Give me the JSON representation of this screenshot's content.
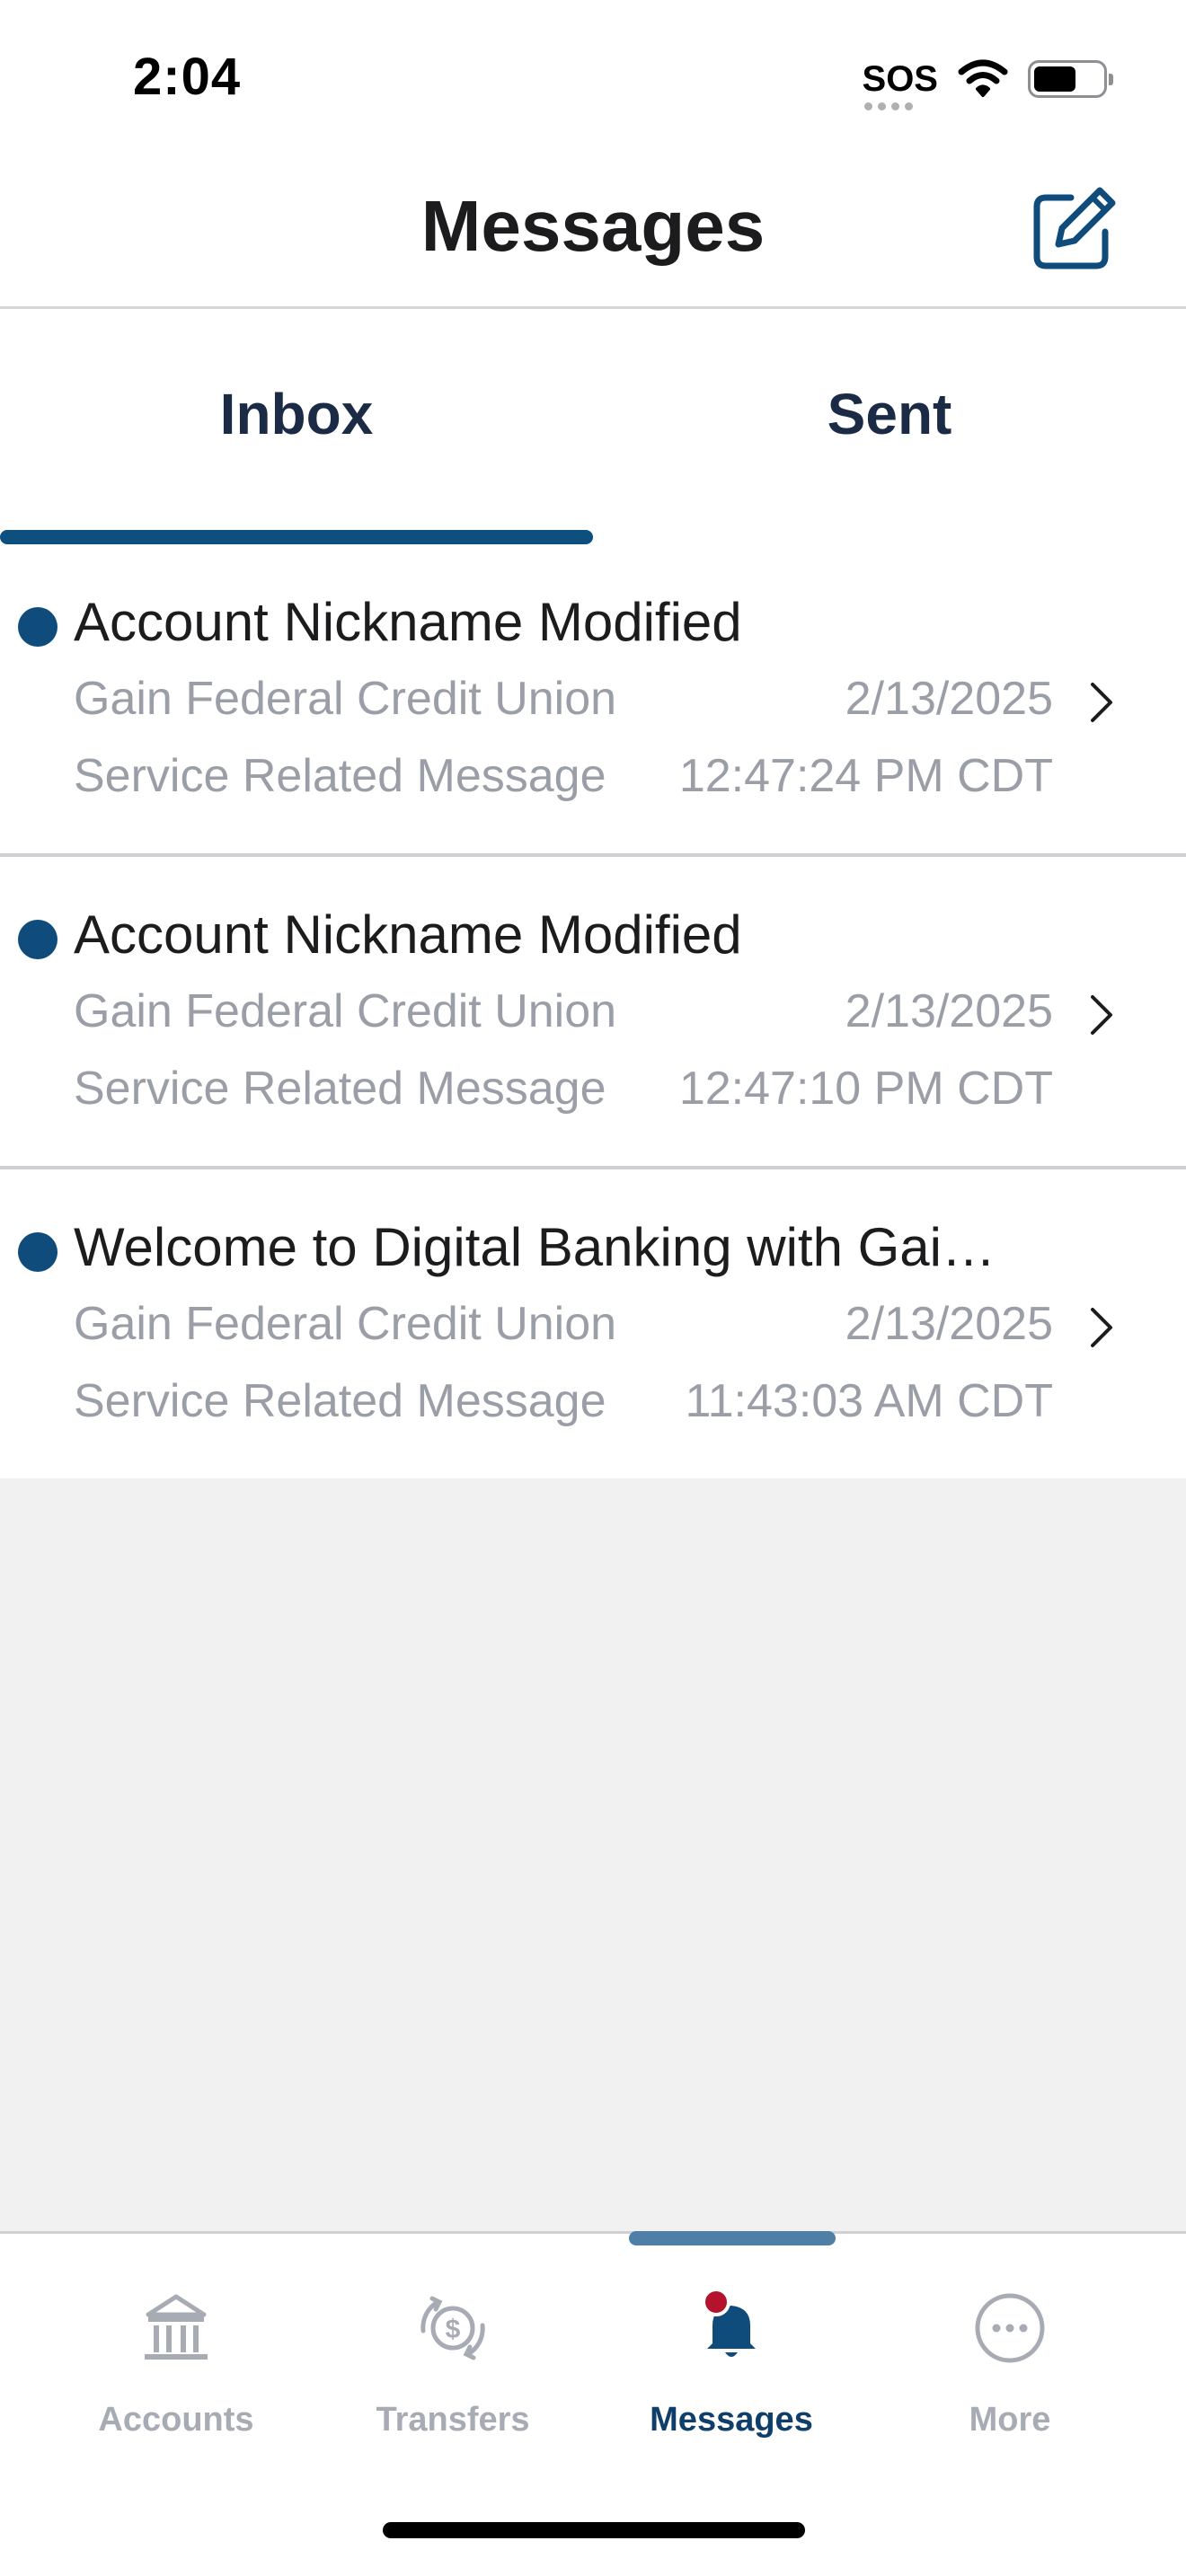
{
  "status_bar": {
    "time": "2:04",
    "sos": "SOS"
  },
  "header": {
    "title": "Messages",
    "compose_icon": "compose-icon"
  },
  "tabs": [
    {
      "label": "Inbox",
      "active": true
    },
    {
      "label": "Sent",
      "active": false
    }
  ],
  "messages": [
    {
      "title": "Account Nickname Modified",
      "sender": "Gain Federal Credit Union",
      "category": "Service Related Message",
      "date": "2/13/2025",
      "time": "12:47:24 PM CDT",
      "unread": true
    },
    {
      "title": "Account Nickname Modified",
      "sender": "Gain Federal Credit Union",
      "category": "Service Related Message",
      "date": "2/13/2025",
      "time": "12:47:10 PM CDT",
      "unread": true
    },
    {
      "title": "Welcome to Digital Banking with Gai…",
      "sender": "Gain Federal Credit Union",
      "category": "Service Related Message",
      "date": "2/13/2025",
      "time": "11:43:03 AM CDT",
      "unread": true
    }
  ],
  "bottom_nav": [
    {
      "label": "Accounts",
      "icon": "bank-icon",
      "active": false
    },
    {
      "label": "Transfers",
      "icon": "transfer-icon",
      "active": false
    },
    {
      "label": "Messages",
      "icon": "bell-icon",
      "active": true,
      "badge": true
    },
    {
      "label": "More",
      "icon": "more-icon",
      "active": false
    }
  ],
  "colors": {
    "accent": "#0f4c7c",
    "tab_indicator": "#0d4f7e",
    "badge": "#b3132b",
    "muted_text": "#9a9ea6",
    "empty_background": "#f1f1f2"
  }
}
